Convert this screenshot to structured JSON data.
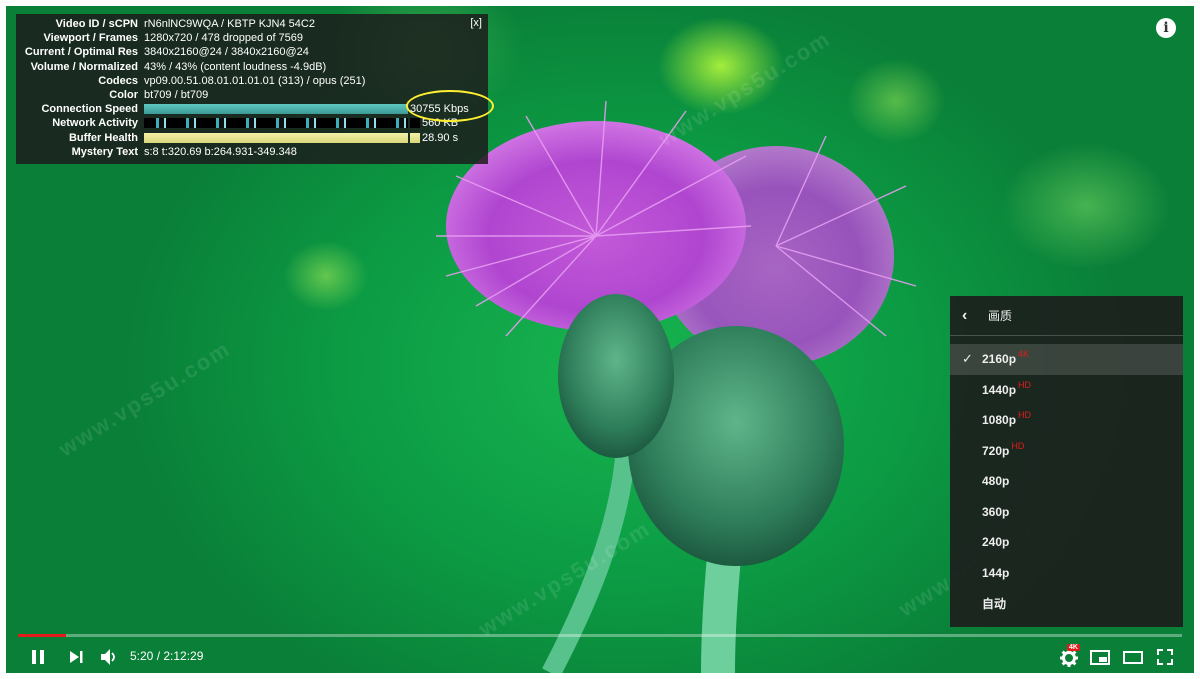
{
  "stats": {
    "close": "[x]",
    "rows": [
      {
        "label": "Video ID / sCPN",
        "value": "rN6nlNC9WQA / KBTP KJN4 54C2"
      },
      {
        "label": "Viewport / Frames",
        "value": "1280x720 / 478 dropped of 7569"
      },
      {
        "label": "Current / Optimal Res",
        "value": "3840x2160@24 / 3840x2160@24"
      },
      {
        "label": "Volume / Normalized",
        "value": "43% / 43% (content loudness -4.9dB)"
      },
      {
        "label": "Codecs",
        "value": "vp09.00.51.08.01.01.01.01 (313) / opus (251)"
      },
      {
        "label": "Color",
        "value": "bt709 / bt709"
      },
      {
        "label": "Connection Speed",
        "value": "30755 Kbps"
      },
      {
        "label": "Network Activity",
        "value": "560 KB"
      },
      {
        "label": "Buffer Health",
        "value": "28.90 s"
      },
      {
        "label": "Mystery Text",
        "value": "s:8 t:320.69 b:264.931-349.348"
      }
    ]
  },
  "info_icon": "i",
  "watermark": "www.vps5u.com",
  "quality_menu": {
    "title": "画质",
    "items": [
      {
        "label": "2160p",
        "badge": "4K",
        "selected": true
      },
      {
        "label": "1440p",
        "badge": "HD",
        "selected": false
      },
      {
        "label": "1080p",
        "badge": "HD",
        "selected": false
      },
      {
        "label": "720p",
        "badge": "HD",
        "selected": false
      },
      {
        "label": "480p",
        "badge": "",
        "selected": false
      },
      {
        "label": "360p",
        "badge": "",
        "selected": false
      },
      {
        "label": "240p",
        "badge": "",
        "selected": false
      },
      {
        "label": "144p",
        "badge": "",
        "selected": false
      },
      {
        "label": "自动",
        "badge": "",
        "selected": false
      }
    ]
  },
  "player": {
    "current_time": "5:20",
    "duration": "2:12:29",
    "time_text": "5:20 / 2:12:29",
    "settings_badge": "4K",
    "progress_fraction": 0.041
  },
  "colors": {
    "accent": "#e21b1b",
    "highlight": "#ffee33",
    "panel": "#1c1c1c"
  }
}
